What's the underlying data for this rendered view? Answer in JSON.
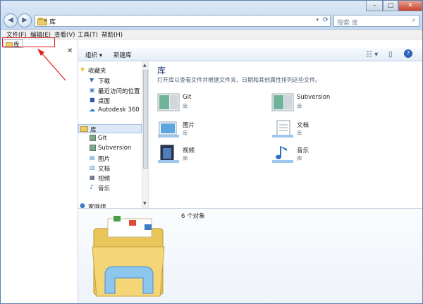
{
  "window": {
    "address_crumb": "库",
    "search_placeholder": "搜索 库",
    "controls": {
      "minimize": "–",
      "maximize": "□",
      "close": "✕"
    }
  },
  "menu": {
    "items": [
      "文件(F)",
      "编辑(E)",
      "查看(V)",
      "工具(T)",
      "帮助(H)"
    ]
  },
  "library_tab": {
    "label": "库"
  },
  "toolbar": {
    "organize": "组织 ▾",
    "new_library": "新建库"
  },
  "nav": {
    "favorites": "收藏夹",
    "downloads": "下载",
    "recent": "最近访问的位置",
    "desktop": "桌面",
    "autodesk": "Autodesk 360",
    "libraries": "库",
    "git": "Git",
    "subversion": "Subversion",
    "pictures": "图片",
    "documents": "文档",
    "videos": "视频",
    "music": "音乐",
    "homegroup": "家庭组"
  },
  "content": {
    "title": "库",
    "subtitle": "打开库以查看文件并根据文件夹、日期和其他属性排列这些文件。",
    "tiles": [
      {
        "name": "Git",
        "type": "库"
      },
      {
        "name": "Subversion",
        "type": "库"
      },
      {
        "name": "图片",
        "type": "库"
      },
      {
        "name": "文档",
        "type": "库"
      },
      {
        "name": "视频",
        "type": "库"
      },
      {
        "name": "音乐",
        "type": "库"
      }
    ]
  },
  "details": {
    "count": "6 个对象"
  },
  "colors": {
    "accent": "#1e3d6e",
    "annotation": "#e11a1a",
    "selection": "#dde9f8"
  }
}
